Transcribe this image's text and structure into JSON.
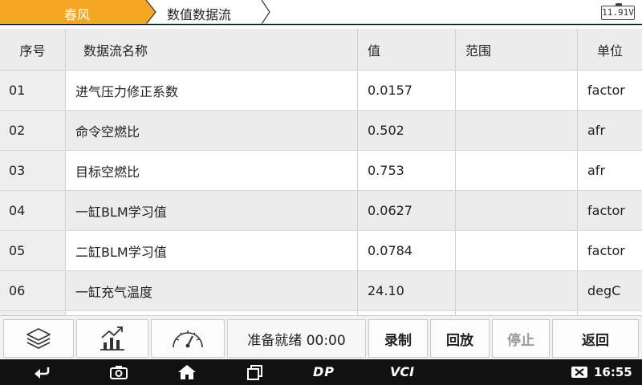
{
  "breadcrumb": {
    "items": [
      "春风",
      "数值数据流"
    ],
    "accent_color": "#f5a623"
  },
  "battery": {
    "voltage": "11.91V"
  },
  "table": {
    "headers": [
      "序号",
      "数据流名称",
      "值",
      "范围",
      "单位"
    ],
    "rows": [
      {
        "no": "01",
        "name": "进气压力修正系数",
        "value": "0.0157",
        "range": "",
        "unit": "factor"
      },
      {
        "no": "02",
        "name": "命令空燃比",
        "value": "0.502",
        "range": "",
        "unit": "afr"
      },
      {
        "no": "03",
        "name": "目标空燃比",
        "value": "0.753",
        "range": "",
        "unit": "afr"
      },
      {
        "no": "04",
        "name": "一缸BLM学习值",
        "value": "0.0627",
        "range": "",
        "unit": "factor"
      },
      {
        "no": "05",
        "name": "二缸BLM学习值",
        "value": "0.0784",
        "range": "",
        "unit": "factor"
      },
      {
        "no": "06",
        "name": "一缸充气温度",
        "value": "24.10",
        "range": "",
        "unit": "degC"
      }
    ]
  },
  "toolbar": {
    "icons": [
      "layers-icon",
      "chart-icon",
      "gauge-icon"
    ],
    "status_text": "准备就绪 00:00",
    "record_label": "录制",
    "playback_label": "回放",
    "stop_label": "停止",
    "back_label": "返回"
  },
  "navbar": {
    "icons": [
      "back-icon",
      "camera-icon",
      "home-icon",
      "recents-icon",
      "wifi-icon",
      "no-sim-icon"
    ],
    "dp_label": "DP",
    "vci_label": "VCI",
    "time": "16:55"
  }
}
